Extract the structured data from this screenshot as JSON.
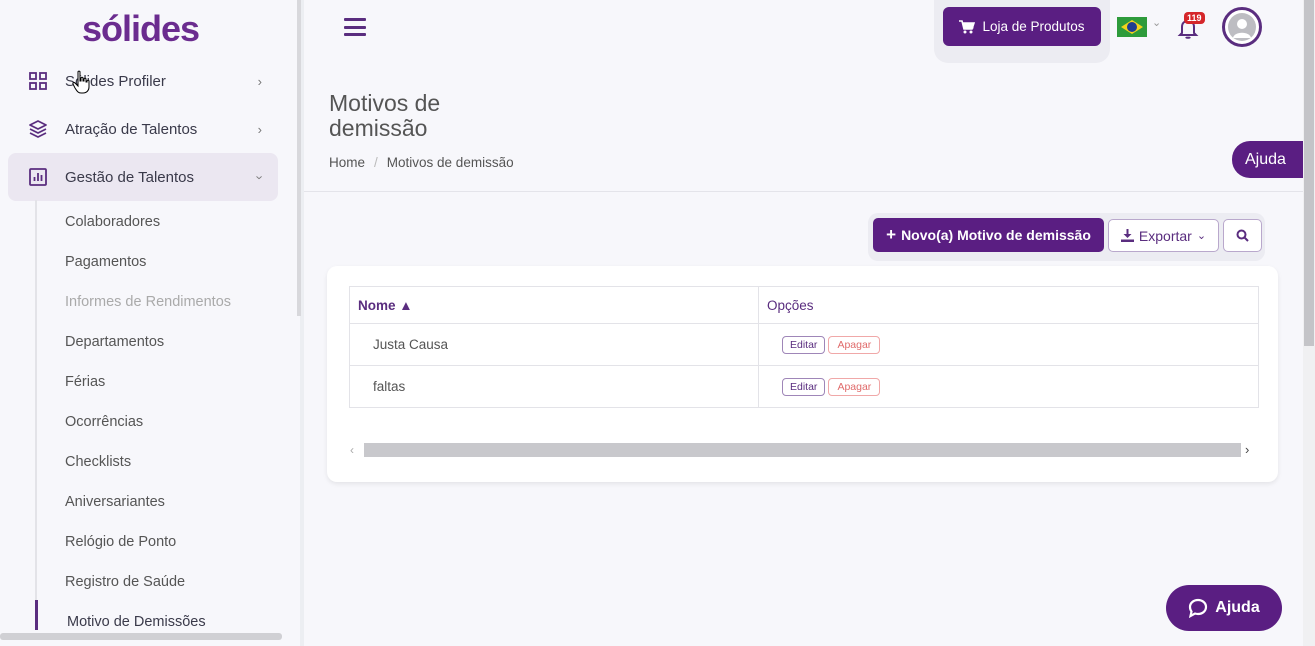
{
  "brand": {
    "logo": "sólides"
  },
  "sidebar": {
    "items": [
      {
        "label": "Sólides Profiler",
        "icon": "grid-icon",
        "expanded": false
      },
      {
        "label": "Atração de Talentos",
        "icon": "layers-icon",
        "expanded": false
      },
      {
        "label": "Gestão de Talentos",
        "icon": "bar-chart-icon",
        "expanded": true
      }
    ],
    "subitems": [
      "Colaboradores",
      "Pagamentos",
      "Informes de Rendimentos",
      "Departamentos",
      "Férias",
      "Ocorrências",
      "Checklists",
      "Aniversariantes",
      "Relógio de Ponto",
      "Registro de Saúde",
      "Motivo de Demissões"
    ]
  },
  "header": {
    "shop_label": "Loja de Produtos",
    "notifications_count": "119"
  },
  "page": {
    "title": "Motivos de demissão",
    "breadcrumb": [
      "Home",
      "Motivos de demissão"
    ],
    "help_tab": "Ajuda"
  },
  "toolbar": {
    "new_label": "Novo(a) Motivo de demissão",
    "export_label": "Exportar"
  },
  "table": {
    "columns": [
      "Nome ▲",
      "Opções"
    ],
    "rows": [
      {
        "name": "Justa Causa",
        "edit": "Editar",
        "delete": "Apagar"
      },
      {
        "name": "faltas",
        "edit": "Editar",
        "delete": "Apagar"
      }
    ]
  },
  "help_button": "Ajuda",
  "colors": {
    "brand": "#5a1e82",
    "danger": "#e06b6b"
  }
}
